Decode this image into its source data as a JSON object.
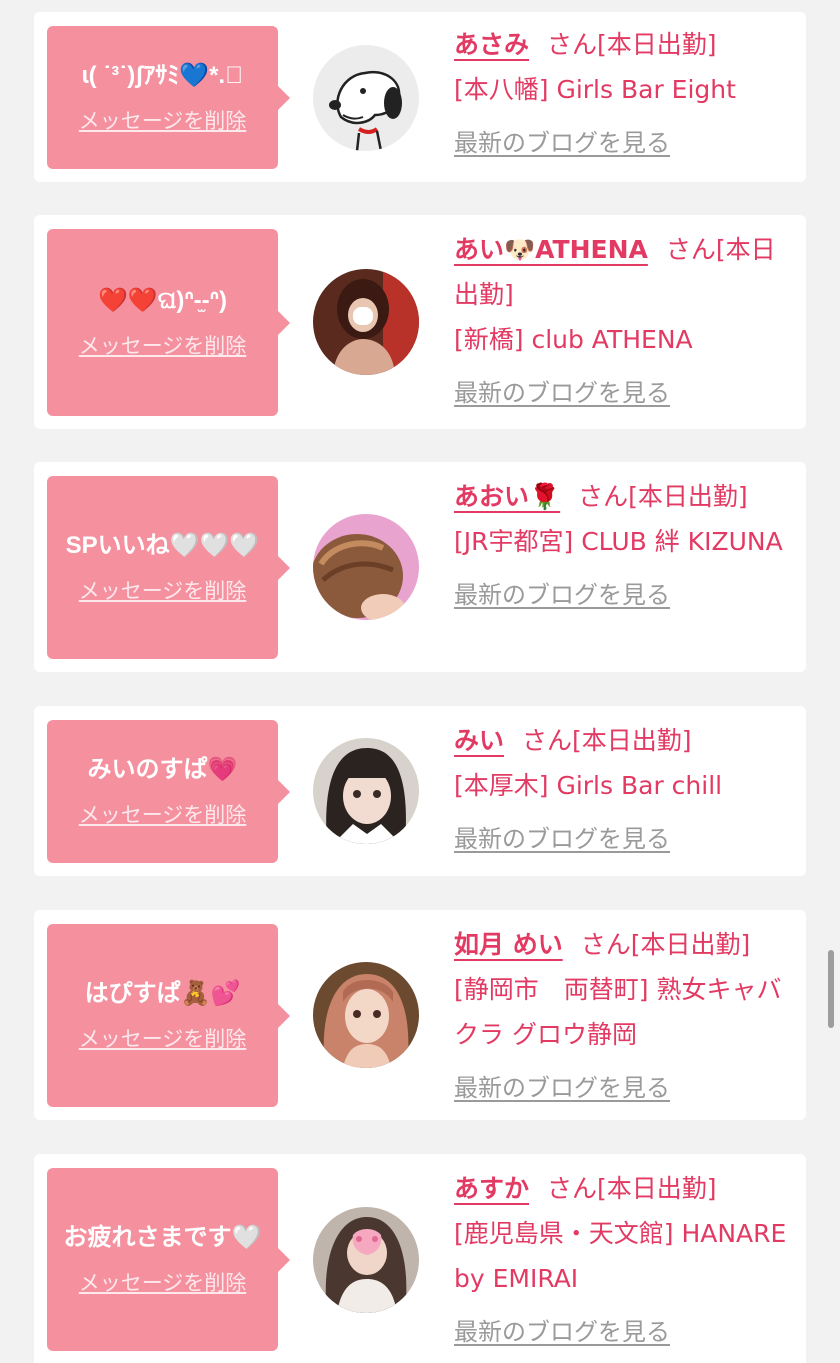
{
  "delete_label": "メッセージを削除",
  "blog_label": "最新のブログを見る",
  "san_suffix": "さん",
  "colors": {
    "background": "#f2f2f2",
    "bubble": "#f5909f",
    "name": "#e23a63",
    "blog_link": "#9a9a9a"
  },
  "items": [
    {
      "message": "ɩ( ˙³˙)ʃｱｻﾐ💙*.ﾟ",
      "name": "あさみ",
      "status": "[本日出勤]",
      "store": "[本八幡] Girls Bar Eight",
      "avatar_icon": "snoopy-avatar"
    },
    {
      "message": "❤️❤️ଘ)ᐢ-̫-ᐢ)",
      "name": "あい🐶ATHENA",
      "status": "[本日出勤]",
      "store": "[新橋] club ATHENA",
      "avatar_icon": "photo-avatar"
    },
    {
      "message": "SPいいね🤍🤍🤍",
      "name": "あおい🌹",
      "status": "[本日出勤]",
      "store": "[JR宇都宮] CLUB 絆 KIZUNA",
      "avatar_icon": "photo-avatar"
    },
    {
      "message": "みいのすぱ💗",
      "name": "みい",
      "status": "[本日出勤]",
      "store": "[本厚木] Girls Bar chill",
      "avatar_icon": "photo-avatar"
    },
    {
      "message": "はぴすぱ🧸💕",
      "name": "如月 めい",
      "status": "[本日出勤]",
      "store": "[静岡市　両替町] 熟女キャバクラ グロウ静岡",
      "avatar_icon": "photo-avatar"
    },
    {
      "message": "お疲れさまです🤍",
      "name": "あすか",
      "status": "[本日出勤]",
      "store": "[鹿児島県・天文館] HANARE by EMIRAI",
      "avatar_icon": "photo-avatar"
    }
  ]
}
